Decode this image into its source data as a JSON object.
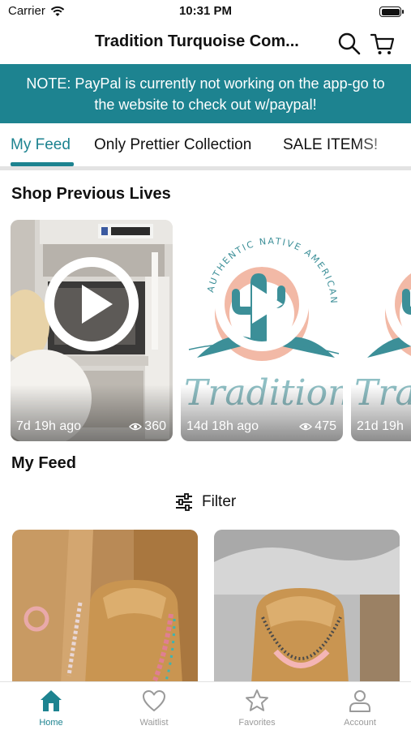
{
  "status_bar": {
    "carrier": "Carrier",
    "time": "10:31 PM"
  },
  "header": {
    "title": "Tradition Turquoise Com..."
  },
  "notice": {
    "line1": "NOTE: PayPal is currently not working on the app-go to",
    "line2": "the website to check out w/paypal!"
  },
  "tabs": [
    {
      "label": "My Feed",
      "active": true
    },
    {
      "label": "Only Prettier Collection",
      "active": false
    },
    {
      "label": "SALE ITEMS!",
      "active": false
    }
  ],
  "lives_section": {
    "title": "Shop Previous Lives"
  },
  "lives": [
    {
      "time": "7d 19h ago",
      "views": "360"
    },
    {
      "time": "14d 18h ago",
      "views": "475"
    },
    {
      "time": "21d 19h",
      "views": ""
    }
  ],
  "logo_text": {
    "arc": "AUTHENTIC NATIVE AMERICAN MADE",
    "script": "Tradition"
  },
  "feed_section": {
    "title": "My Feed",
    "filter_label": "Filter"
  },
  "bottom_nav": [
    {
      "label": "Home",
      "icon": "home-icon",
      "active": true
    },
    {
      "label": "Waitlist",
      "icon": "heart-icon",
      "active": false
    },
    {
      "label": "Favorites",
      "icon": "star-icon",
      "active": false
    },
    {
      "label": "Account",
      "icon": "person-icon",
      "active": false
    }
  ],
  "colors": {
    "accent": "#1d8390",
    "notice_bg": "#1d8390",
    "inactive": "#9a9a9a",
    "logo_peach": "#f2b9a6",
    "logo_teal": "#3c8f98"
  }
}
